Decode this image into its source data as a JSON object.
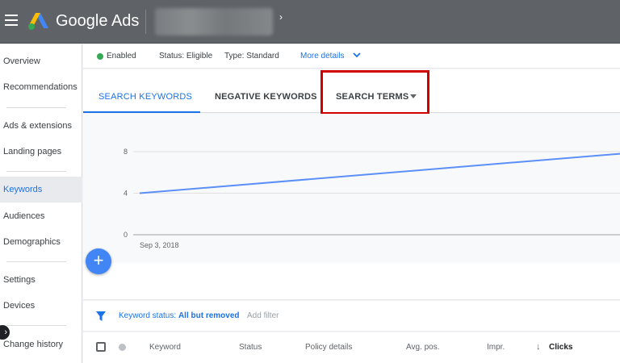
{
  "header": {
    "brand": "Google Ads"
  },
  "sidebar": {
    "items": [
      {
        "label": "Overview"
      },
      {
        "label": "Recommendations"
      },
      {
        "label": "Ads & extensions"
      },
      {
        "label": "Landing pages"
      },
      {
        "label": "Keywords"
      },
      {
        "label": "Audiences"
      },
      {
        "label": "Demographics"
      },
      {
        "label": "Settings"
      },
      {
        "label": "Devices"
      },
      {
        "label": "Change history"
      }
    ],
    "active": "Keywords"
  },
  "status": {
    "enabled": "Enabled",
    "status_text": "Status: Eligible",
    "type_text": "Type: Standard",
    "more_details": "More details"
  },
  "tabs": [
    {
      "label": "SEARCH KEYWORDS",
      "selected": true
    },
    {
      "label": "NEGATIVE KEYWORDS",
      "selected": false
    },
    {
      "label": "SEARCH TERMS",
      "selected": false
    }
  ],
  "chart_data": {
    "type": "line",
    "x": [
      "Sep 3, 2018"
    ],
    "x_tick_labels": [
      "Sep 3, 2018"
    ],
    "y_ticks": [
      "0",
      "4",
      "8"
    ],
    "ylim": [
      0,
      8
    ],
    "series": [
      {
        "values": [
          4,
          7.8
        ],
        "color": "#5b8ff9"
      }
    ],
    "grid": true
  },
  "filter": {
    "prefix": "Keyword status:",
    "value": "All but removed",
    "add": "Add filter"
  },
  "table": {
    "columns": [
      "Keyword",
      "Status",
      "Policy details",
      "Avg. pos.",
      "Impr.",
      "Clicks"
    ],
    "sort_icon": "↓"
  },
  "colors": {
    "accent": "#1a73e8",
    "highlight": "#d10000",
    "enabled": "#34a853"
  }
}
